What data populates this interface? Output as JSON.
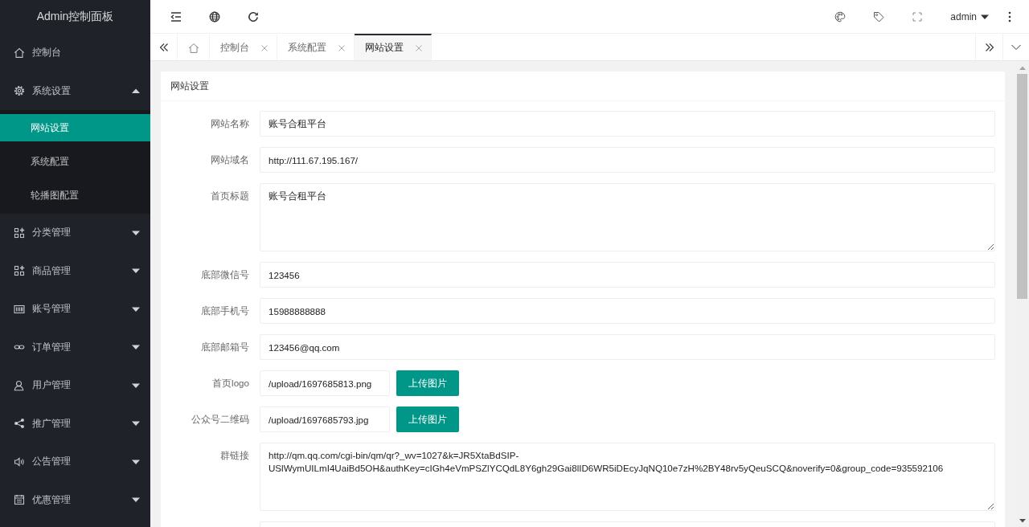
{
  "sidebar": {
    "logo": "Admin控制面板",
    "items": [
      {
        "kind": "link",
        "label": "控制台",
        "selected": false
      },
      {
        "kind": "menu",
        "label": "系统设置",
        "selected": false,
        "expanded": true,
        "children": [
          {
            "label": "网站设置",
            "selected": true
          },
          {
            "label": "系统配置",
            "selected": false
          },
          {
            "label": "轮播图配置",
            "selected": false
          }
        ]
      },
      {
        "kind": "menu",
        "label": "分类管理",
        "selected": false,
        "expanded": false
      },
      {
        "kind": "menu",
        "label": "商品管理",
        "selected": false,
        "expanded": false
      },
      {
        "kind": "menu",
        "label": "账号管理",
        "selected": false,
        "expanded": false
      },
      {
        "kind": "menu",
        "label": "订单管理",
        "selected": false,
        "expanded": false
      },
      {
        "kind": "menu",
        "label": "用户管理",
        "selected": false,
        "expanded": false
      },
      {
        "kind": "menu",
        "label": "推广管理",
        "selected": false,
        "expanded": false
      },
      {
        "kind": "menu",
        "label": "公告管理",
        "selected": false,
        "expanded": false
      },
      {
        "kind": "menu",
        "label": "优惠管理",
        "selected": false,
        "expanded": false
      }
    ]
  },
  "header": {
    "user": "admin"
  },
  "tabs": [
    {
      "kind": "home",
      "selected": false
    },
    {
      "kind": "page",
      "label": "控制台",
      "selected": false
    },
    {
      "kind": "page",
      "label": "系统配置",
      "selected": false
    },
    {
      "kind": "page",
      "label": "网站设置",
      "selected": true
    }
  ],
  "card": {
    "title": "网站设置",
    "fields": [
      {
        "kind": "input",
        "label": "网站名称",
        "value": "账号合租平台"
      },
      {
        "kind": "input",
        "label": "网站域名",
        "value": "http://111.67.195.167/"
      },
      {
        "kind": "textarea",
        "label": "首页标题",
        "value": "账号合租平台"
      },
      {
        "kind": "input",
        "label": "底部微信号",
        "value": "123456"
      },
      {
        "kind": "input",
        "label": "底部手机号",
        "value": "15988888888"
      },
      {
        "kind": "input",
        "label": "底部邮箱号",
        "value": "123456@qq.com"
      },
      {
        "kind": "upload",
        "label": "首页logo",
        "value": "/upload/1697685813.png",
        "button": "上传图片"
      },
      {
        "kind": "upload",
        "label": "公众号二维码",
        "value": "/upload/1697685793.jpg",
        "button": "上传图片"
      },
      {
        "kind": "textarea",
        "label": "群链接",
        "value": "http://qm.qq.com/cgi-bin/qm/qr?_wv=1027&k=JR5XtaBdSIP-USlWymUILmI4UaiBd5OH&authKey=cIGh4eVmPSZlYCQdL8Y6gh29Gai8lID6WR5iDEcyJqNQ10e7zH%2BY48rv5yQeuSCQ&noverify=0&group_code=935592106"
      },
      {
        "kind": "input"
      }
    ]
  }
}
